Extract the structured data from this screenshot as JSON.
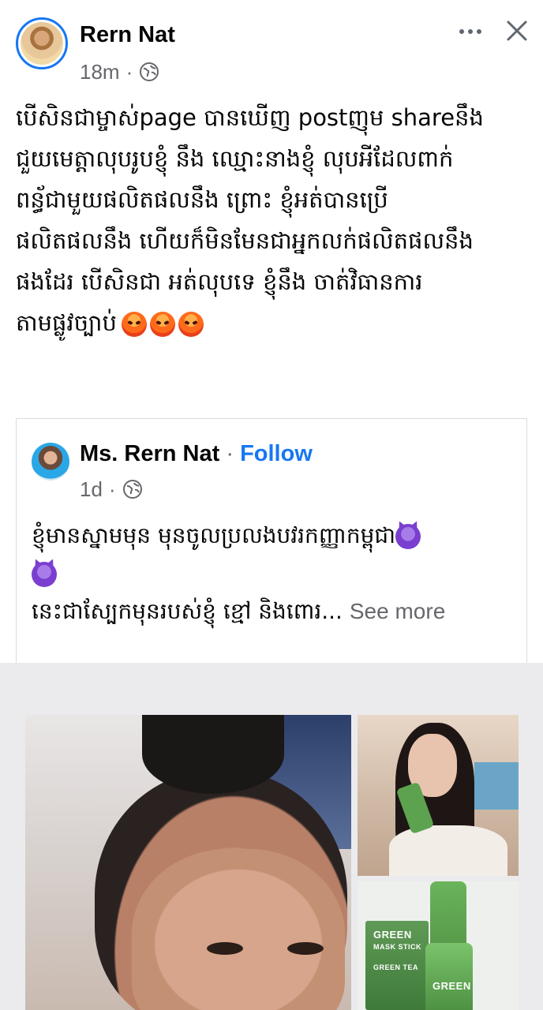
{
  "post": {
    "author": "Rern Nat",
    "time": "18m",
    "audience_icon": "globe-icon",
    "lines": [
      "បើសិនជាម្ចាស់page បានឃើញ postញុម shareនឹង",
      "ជួយមេត្តាលុបរូបខ្ញុំ នឹង ឈ្មោះនាងខ្ញុំ លុបអីដែលពាក់",
      "ពន្ធ័ជាមួយផលិតផលនឹង ព្រោះ ខ្ញុំអត់បានប្រើ",
      "ផលិតផលនឹង ហើយក៏មិនមែនជាអ្នកលក់ផលិតផលនឹង",
      "ផងដែរ បើសិនជា អត់លុបទេ ខ្ញុំនឹង ចាត់វិធានការ",
      "តាមផ្លូវច្បាប់"
    ],
    "emoji": [
      "angry-face-icon",
      "angry-face-icon",
      "angry-face-icon"
    ]
  },
  "shared": {
    "author": "Ms. Rern Nat",
    "separator": "·",
    "follow_label": "Follow",
    "time": "1d",
    "lines": [
      "ខ្ញុំមានស្នាមមុន មុនចូលប្រលងបវរកញ្ញាកម្ពុជា",
      "",
      "នេះជាស្បែកមុនរបស់ខ្ញុំ ខ្មៅ និងពោរ..."
    ],
    "see_more": "See more"
  },
  "colors": {
    "accent": "#1877f2",
    "secondary_text": "#65676b",
    "media_bg": "#ebebed"
  },
  "media": {
    "product_label_top": "GREEN",
    "product_label_mid": "MASK STICK",
    "product_label_tea": "GREEN TEA",
    "product_label_bottom": "GREEN"
  }
}
